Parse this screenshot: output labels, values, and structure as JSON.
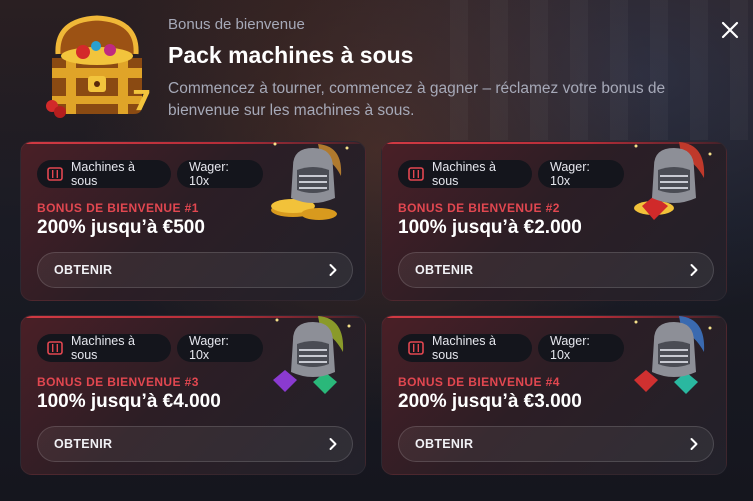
{
  "header": {
    "subtitle": "Bonus de bienvenue",
    "title": "Pack machines à sous",
    "description": "Commencez à tourner, commencez à gagner – réclamez votre bonus de bienvenue sur les machines à sous."
  },
  "cards": [
    {
      "tag": "Machines à sous",
      "wager": "Wager: 10x",
      "label": "BONUS DE BIENVENUE #1",
      "value": "200% jusqu’à €500",
      "button": "OBTENIR",
      "plume_color": "#b07a2e",
      "gem_color": "#e0a020"
    },
    {
      "tag": "Machines à sous",
      "wager": "Wager: 10x",
      "label": "BONUS DE BIENVENUE #2",
      "value": "100% jusqu’à €2.000",
      "button": "OBTENIR",
      "plume_color": "#c0392b",
      "gem_color": "#d02a2a"
    },
    {
      "tag": "Machines à sous",
      "wager": "Wager: 10x",
      "label": "BONUS DE BIENVENUE #3",
      "value": "100% jusqu’à €4.000",
      "button": "OBTENIR",
      "plume_color": "#8a9a2a",
      "gem_color": "#8a3ad0"
    },
    {
      "tag": "Machines à sous",
      "wager": "Wager: 10x",
      "label": "BONUS DE BIENVENUE #4",
      "value": "200% jusqu’à €3.000",
      "button": "OBTENIR",
      "plume_color": "#3a6ab0",
      "gem_color": "#d03030"
    }
  ],
  "colors": {
    "accent": "#e24750",
    "text_muted": "#a6a9b8"
  }
}
